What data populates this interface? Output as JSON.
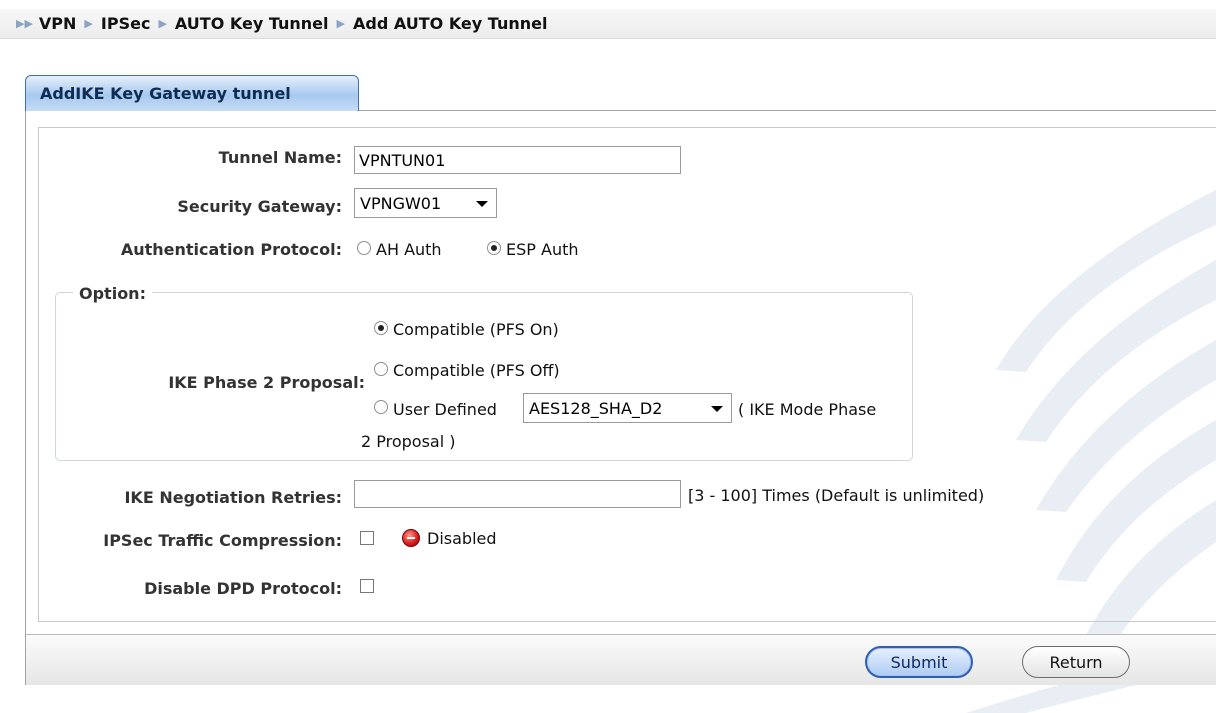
{
  "breadcrumb": [
    "VPN",
    "IPSec",
    "AUTO Key Tunnel",
    "Add AUTO Key Tunnel"
  ],
  "tab": {
    "label": "AddIKE Key Gateway tunnel"
  },
  "form": {
    "tunnel_name": {
      "label": "Tunnel Name:",
      "value": "VPNTUN01"
    },
    "security_gateway": {
      "label": "Security Gateway:",
      "value": "VPNGW01"
    },
    "auth_protocol": {
      "label": "Authentication Protocol:",
      "options": [
        {
          "label": "AH Auth",
          "checked": false
        },
        {
          "label": "ESP Auth",
          "checked": true
        }
      ]
    },
    "option_group": {
      "legend": "Option:",
      "ike_phase2": {
        "label": "IKE Phase 2 Proposal:",
        "options": [
          {
            "label": "Compatible (PFS On)",
            "checked": true
          },
          {
            "label": "Compatible (PFS Off)",
            "checked": false
          },
          {
            "label": "User Defined",
            "checked": false
          }
        ],
        "user_defined_select": "AES128_SHA_D2",
        "hint_part1": "( IKE Mode Phase",
        "hint_part2": "2 Proposal )"
      }
    },
    "negotiation_retries": {
      "label": "IKE Negotiation Retries:",
      "value": "",
      "hint": "[3 - 100] Times (Default is unlimited)"
    },
    "traffic_compression": {
      "label": "IPSec Traffic Compression:",
      "checked": false,
      "status": "Disabled",
      "status_color": "#d6161a"
    },
    "disable_dpd": {
      "label": "Disable DPD Protocol:",
      "checked": false
    }
  },
  "buttons": {
    "submit": "Submit",
    "return": "Return"
  },
  "colors": {
    "tab_border": "#3d6fb8",
    "submit_border": "#2f5fb3",
    "breadcrumb_arrow": "#8aa2c4"
  }
}
